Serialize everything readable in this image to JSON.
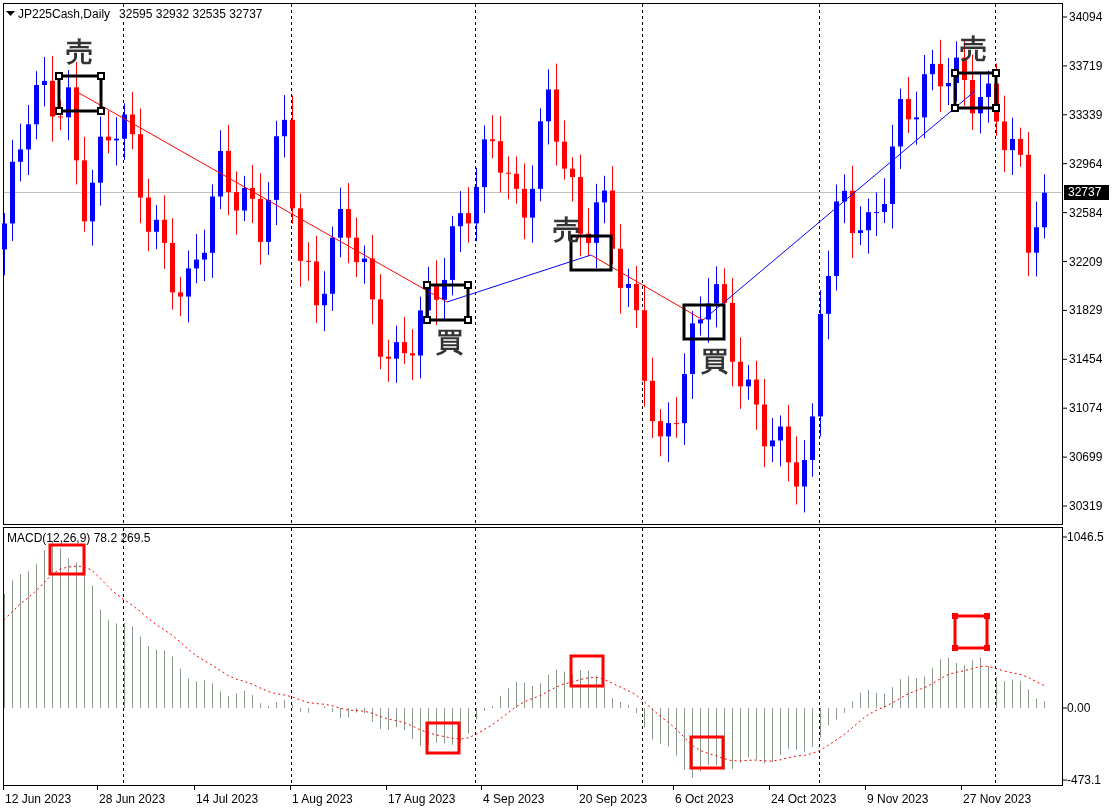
{
  "header": {
    "symbol": "JP225Cash,Daily",
    "ohlc": "32595 32932 32535 32737"
  },
  "price_axis": {
    "ticks": [
      "34094",
      "33719",
      "33339",
      "32964",
      "32584",
      "32209",
      "31829",
      "31454",
      "31074",
      "30699",
      "30319"
    ],
    "current_price": "32737"
  },
  "signals": [
    {
      "kind": "sell",
      "label": "売",
      "selected": true,
      "macd_box_selected": false
    },
    {
      "kind": "buy",
      "label": "買",
      "selected": true,
      "macd_box_selected": false
    },
    {
      "kind": "sell",
      "label": "売",
      "selected": false,
      "macd_box_selected": false
    },
    {
      "kind": "buy",
      "label": "買",
      "selected": false,
      "macd_box_selected": false
    },
    {
      "kind": "sell",
      "label": "売",
      "selected": true,
      "macd_box_selected": true
    }
  ],
  "macd": {
    "title": "MACD(12,26,9) 78.2 269.5",
    "ticks": [
      "1046.5",
      "0.00",
      "-473.1"
    ]
  },
  "date_axis": [
    "12 Jun 2023",
    "28 Jun 2023",
    "14 Jul 2023",
    "1 Aug 2023",
    "17 Aug 2023",
    "4 Sep 2023",
    "20 Sep 2023",
    "6 Oct 2023",
    "24 Oct 2023",
    "9 Nov 2023",
    "27 Nov 2023"
  ]
}
